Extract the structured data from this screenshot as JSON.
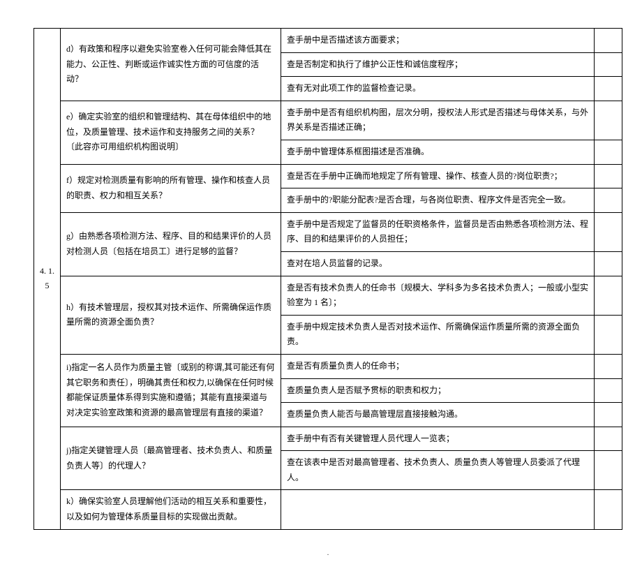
{
  "section": "4. 1. 5",
  "rows": [
    {
      "q": "d）有政策和程序以避免实验室卷入任何可能会降低其在能力、公正性、判断或运作诚实性方面的可信度的活动？",
      "checks": [
        "查手册中是否描述该方面要求；",
        "查是否制定和执行了维护公正性和诚信度程序；",
        "查有无对此项工作的监督检查记录。"
      ]
    },
    {
      "q": "e）确定实验室的组织和管理结构、其在母体组织中的地位，及质量管理、技术运作和支持服务之间的关系？〔此容亦可用组织机构图说明〕",
      "checks": [
        "查手册中是否有组织机构图，层次分明，授权法人形式是否描述与母体关系，与外界关系是否描述正确；",
        "查手册中管理体系框图描述是否准确。"
      ]
    },
    {
      "q": "f）规定对检测质量有影响的所有管理、操作和核查人员的职责、权力和相互关系？",
      "checks": [
        "查是否在手册中正确而地规定了所有管理、操作、核查人员的?岗位职责?；",
        "查手册中的?职能分配表?是否合理，与各岗位职责、程序文件是否完全一致。"
      ]
    },
    {
      "q": "g）由熟悉各项检测方法、程序、目的和结果评价的人员对检测人员〔包括在培员工〕进行足够的监督？",
      "checks": [
        "查手册中是否规定了监督员的任职资格条件，监督员是否由熟悉各项检测方法、程序、目的和结果评价的人员担任；",
        "查对在培人员监督的记录。"
      ]
    },
    {
      "q": "h）有技术管理层，授权其对技术运作、所需确保运作质量所需的资源全面负责？",
      "checks": [
        "查是否有技术负责人的任命书〔规模大、学科多为多名技术负责人；一般或小型实验室为 1 名〕；",
        "查手册中规定技术负责人是否对技术运作、所需确保运作质量所需的资源全面负责。"
      ]
    },
    {
      "q": "i)指定一名人员作为质量主管〔或别的称谓,其可能还有何其它职务和责任〕，明确其责任和权力,以确保在任何时候都能保证质量体系得到实施和遵循；其能有直接渠道与对决定实验室政策和资源的最高管理层有直接的渠道？",
      "checks": [
        "查是否有质量负责人的任命书；",
        "查质量负责人是否赋予贯标的职责和权力；",
        "查质量负责人能否与最高管理层直接接触沟通。"
      ]
    },
    {
      "q": "j)指定关键管理人员〔最高管理者、技术负责人、和质量负责人等〕的代理人？",
      "checks": [
        "查手册中有否有关键管理人员代理人一览表；",
        "查在该表中是否对最高管理者、技术负责人、质量负责人等管理人员委派了代理人。"
      ]
    },
    {
      "q": "k）确保实验室人员理解他们活动的相互关系和重要性，以及如何为管理体系质量目标的实现做出贡献。",
      "checks": [
        ""
      ]
    }
  ],
  "footer": "."
}
